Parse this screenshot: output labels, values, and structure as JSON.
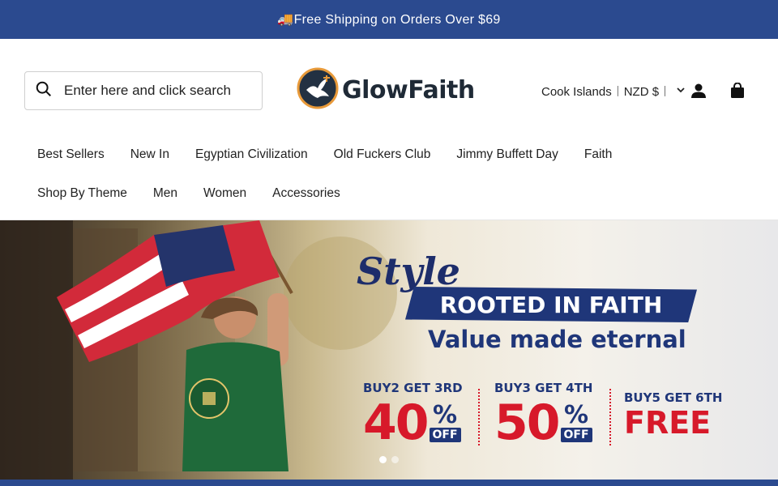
{
  "announcement": {
    "text": "🚚Free Shipping on Orders Over $69"
  },
  "search": {
    "placeholder": "Enter here and click search"
  },
  "logo": {
    "text": "GlowFaith",
    "icon": "dove-icon"
  },
  "currency": {
    "label": "Cook Islands︱NZD $︱"
  },
  "icons": {
    "account": "user-icon",
    "cart": "bag-icon",
    "search": "search-icon",
    "chevron": "chevron-down-icon"
  },
  "nav": {
    "row1": [
      "Best Sellers",
      "New In",
      "Egyptian Civilization",
      "Old Fuckers Club",
      "Jimmy Buffett Day",
      "Faith"
    ],
    "row2": [
      "Shop By Theme",
      "Men",
      "Women",
      "Accessories"
    ]
  },
  "hero": {
    "script_title": "Style",
    "headline": "ROOTED IN FAITH",
    "subline": "Value made eternal",
    "promos": [
      {
        "head": "BUY2 GET 3RD",
        "percent": "40",
        "pct": "%",
        "off": "OFF"
      },
      {
        "head": "BUY3 GET 4TH",
        "percent": "50",
        "pct": "%",
        "off": "OFF"
      },
      {
        "head": "BUY5 GET 6TH",
        "free": "FREE"
      }
    ],
    "slides_total": 2,
    "slide_active": 1
  },
  "colors": {
    "brand_blue": "#2b4a8f",
    "promo_red": "#d7192a",
    "navy": "#1f3679"
  }
}
